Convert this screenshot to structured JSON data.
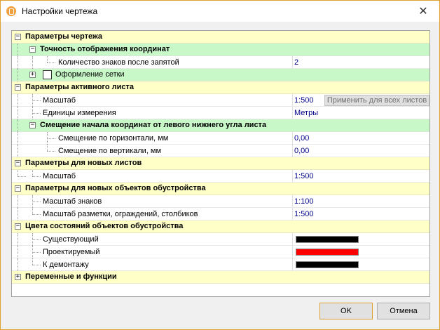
{
  "window": {
    "title": "Настройки чертежа",
    "close_icon": "close-icon",
    "app_icon": "drawing-settings-icon"
  },
  "grid": {
    "cat_drawing": "Параметры чертежа",
    "sub_precision": "Точность отображения координат",
    "decimal_places_label": "Количество знаков после запятой",
    "decimal_places_value": "2",
    "grid_style_label": "Оформление сетки",
    "cat_active_sheet": "Параметры активного листа",
    "scale_label": "Масштаб",
    "scale_value": "1:500",
    "apply_all_label": "Применить для всех листов",
    "units_label": "Единицы измерения",
    "units_value": "Метры",
    "sub_offset": "Смещение начала координат от левого нижнего угла листа",
    "offset_h_label": "Смещение по горизонтали, мм",
    "offset_h_value": "0,00",
    "offset_v_label": "Смещение по вертикали, мм",
    "offset_v_value": "0,00",
    "cat_new_sheets": "Параметры для новых листов",
    "new_scale_label": "Масштаб",
    "new_scale_value": "1:500",
    "cat_new_objects": "Параметры для новых объектов обустройства",
    "sign_scale_label": "Масштаб знаков",
    "sign_scale_value": "1:100",
    "marking_scale_label": "Масштаб разметки, ограждений, столбиков",
    "marking_scale_value": "1:500",
    "cat_colors": "Цвета состояний объектов обустройства",
    "existing_label": "Существующий",
    "designed_label": "Проектируемый",
    "demolish_label": "К демонтажу",
    "cat_variables": "Переменные и функции"
  },
  "colors": {
    "existing": "#000000",
    "designed": "#ff0000",
    "demolish": "#000000",
    "category_bg": "#ffffc8",
    "subcategory_bg": "#c8f8c8"
  },
  "buttons": {
    "ok": "OK",
    "cancel": "Отмена"
  }
}
